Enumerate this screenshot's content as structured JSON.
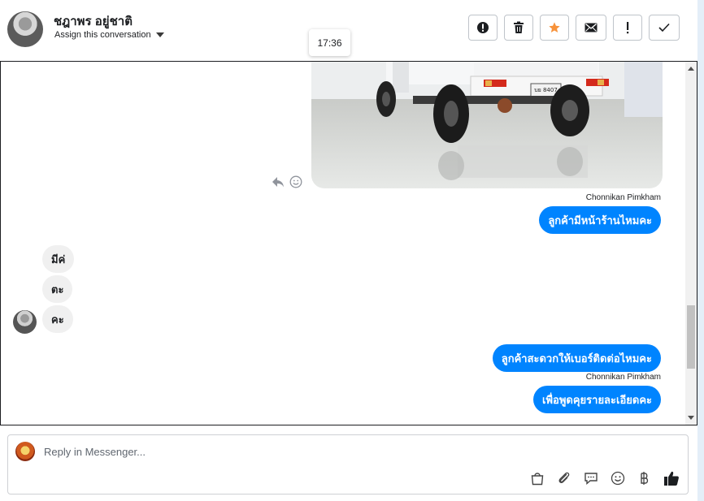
{
  "header": {
    "contact_name": "ชฎาพร อยู่ชาติ",
    "assign_label": "Assign this conversation"
  },
  "toolbar": {
    "buttons": [
      {
        "name": "report-button",
        "icon": "alert-circle-icon"
      },
      {
        "name": "delete-button",
        "icon": "trash-icon"
      },
      {
        "name": "star-button",
        "icon": "star-icon",
        "color": "#f7923a"
      },
      {
        "name": "mark-unread-button",
        "icon": "envelope-icon"
      },
      {
        "name": "important-button",
        "icon": "exclamation-icon"
      },
      {
        "name": "done-button",
        "icon": "check-icon"
      }
    ]
  },
  "tooltip": {
    "time": "17:36"
  },
  "conversation": {
    "photo": {
      "plate_text": "บย 8407"
    },
    "messages": [
      {
        "direction": "out",
        "sender": "Chonnikan Pimkham",
        "text": "ลูกค้ามีหน้าร้านไหมคะ"
      },
      {
        "direction": "in",
        "text": "มีค่"
      },
      {
        "direction": "in",
        "text": "ตะ"
      },
      {
        "direction": "in",
        "text": "คะ"
      },
      {
        "direction": "out",
        "text": "ลูกค้าสะดวกให้เบอร์ติดต่อไหมคะ"
      },
      {
        "direction": "out",
        "sender": "Chonnikan Pimkham",
        "text": "เพื่อพูดคุยรายละเอียดคะ"
      }
    ]
  },
  "reply": {
    "placeholder": "Reply in Messenger...",
    "tools": [
      "bag-icon",
      "paperclip-icon",
      "comment-icon",
      "smiley-icon",
      "baht-icon",
      "thumbs-up-icon"
    ]
  },
  "colors": {
    "accent": "#0084ff",
    "incoming_bubble": "#f0f0f0",
    "star": "#f7923a"
  }
}
